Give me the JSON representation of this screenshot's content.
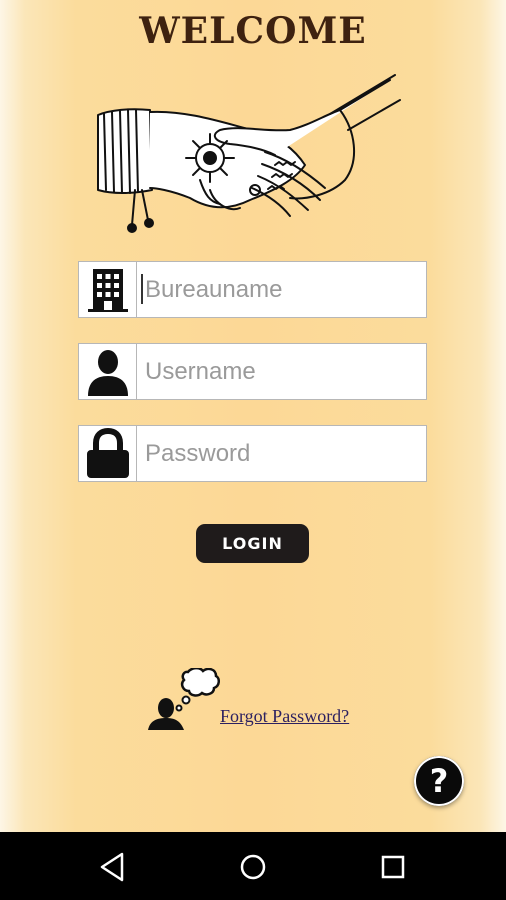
{
  "header": {
    "title": "WELCOME"
  },
  "form": {
    "bureau": {
      "placeholder": "Bureauname",
      "icon": "building-icon"
    },
    "username": {
      "placeholder": "Username",
      "icon": "user-icon"
    },
    "password": {
      "placeholder": "Password",
      "icon": "lock-icon"
    },
    "login_label": "LOGIN"
  },
  "forgot": {
    "label": "Forgot Password?",
    "icon": "thinking-person-icon"
  },
  "help": {
    "label": "?",
    "icon": "help-icon"
  },
  "navbar": {
    "back": "back-icon",
    "home": "home-icon",
    "recents": "recents-icon"
  },
  "colors": {
    "background": "#fcd896",
    "button": "#1f1b1b",
    "title": "#3e2210"
  }
}
